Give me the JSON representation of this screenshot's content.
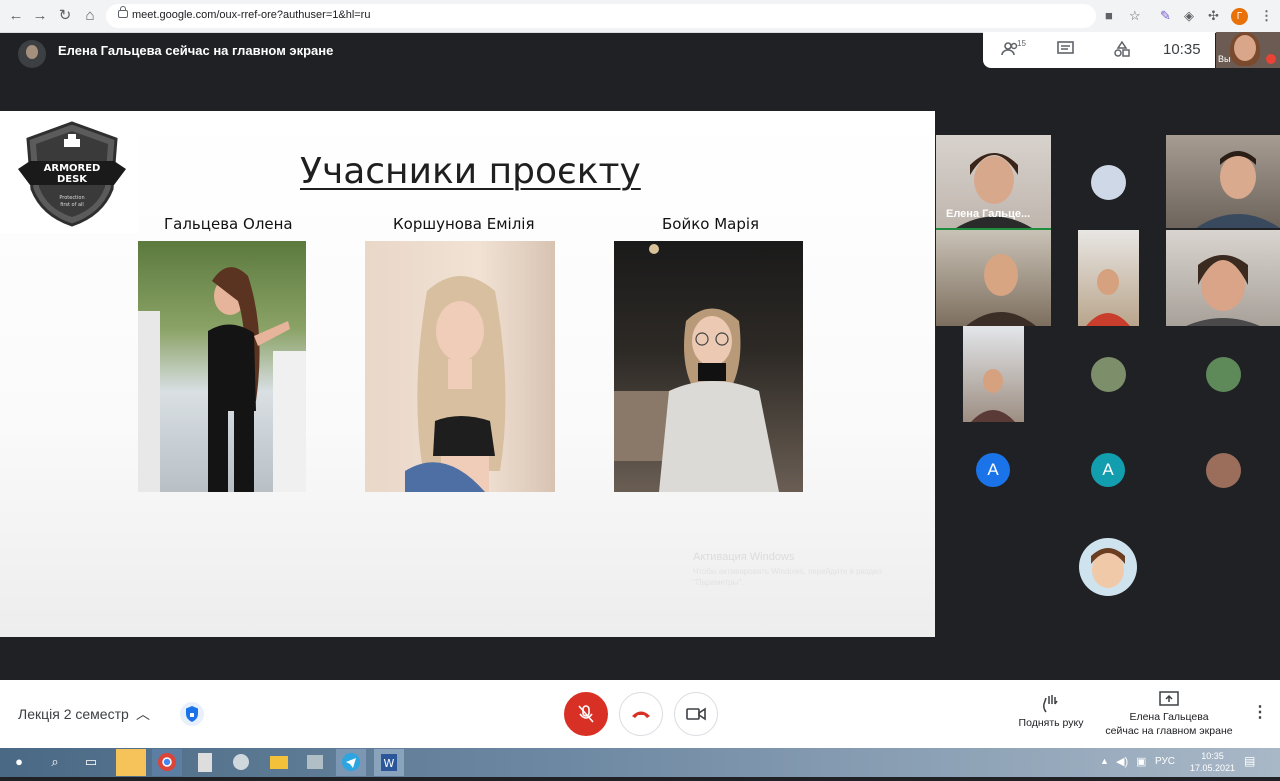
{
  "browser": {
    "url": "meet.google.com/oux-rref-ore?authuser=1&hl=ru",
    "profile_letter": "Г"
  },
  "meet": {
    "banner_text": "Елена Гальцева сейчас на главном экране",
    "participants_count": "15",
    "clock": "10:35",
    "self_label": "Вы",
    "speaker_label": "Елена Гальце...",
    "letter_avatars": [
      "A",
      "A"
    ]
  },
  "slide": {
    "logo_line1": "ARMORED",
    "logo_line2": "DESK",
    "logo_line3": "Protection",
    "logo_line4": "first of all",
    "title": "Учасники проєкту",
    "members": [
      {
        "name": "Гальцева Олена"
      },
      {
        "name": "Коршунова Емілія"
      },
      {
        "name": "Бойко Марія"
      }
    ],
    "watermark_title": "Активация Windows",
    "watermark_sub": "Чтобы активировать Windows, перейдите в раздел \"Параметры\"."
  },
  "bottom_bar": {
    "meeting_name": "Лекція 2 семестр",
    "raise_hand": "Поднять руку",
    "presenting_line1": "Елена Гальцева",
    "presenting_line2": "сейчас на главном экране"
  },
  "taskbar": {
    "language": "РУС",
    "time": "10:35",
    "date": "17.05.2021"
  },
  "colors": {
    "accent_red": "#d93025",
    "meet_dark": "#202124",
    "letter_avatar_blue": "#1a73e8",
    "letter_avatar_teal": "#129eaf"
  }
}
